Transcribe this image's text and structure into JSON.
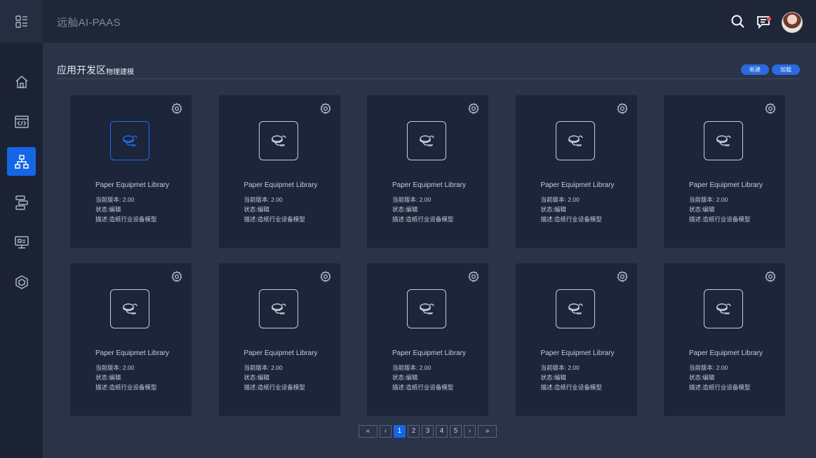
{
  "app": {
    "title": "远舢AI-PAAS"
  },
  "sidebar": {
    "items": [
      {
        "icon": "home-icon"
      },
      {
        "icon": "code-icon"
      },
      {
        "icon": "hierarchy-icon",
        "active": true
      },
      {
        "icon": "workflow-icon"
      },
      {
        "icon": "monitor-icon"
      },
      {
        "icon": "cube-icon"
      }
    ]
  },
  "header": {
    "icons": [
      "search-icon",
      "message-icon",
      "avatar"
    ]
  },
  "section": {
    "title": "应用开发区",
    "subtitle": "物理建模",
    "new_label": "新建",
    "load_label": "加载"
  },
  "cards": [
    {
      "name": "Paper Equipmet Library",
      "version": "当前版本: 2.00",
      "status": "状态:编辑",
      "desc": "描述:造纸行业设备模型",
      "active": true
    },
    {
      "name": "Paper Equipmet Library",
      "version": "当前版本: 2.00",
      "status": "状态:编辑",
      "desc": "描述:造纸行业设备模型"
    },
    {
      "name": "Paper Equipmet Library",
      "version": "当前版本: 2.00",
      "status": "状态:编辑",
      "desc": "描述:造纸行业设备模型"
    },
    {
      "name": "Paper Equipmet Library",
      "version": "当前版本: 2.00",
      "status": "状态:编辑",
      "desc": "描述:造纸行业设备模型"
    },
    {
      "name": "Paper Equipmet Library",
      "version": "当前版本: 2.00",
      "status": "状态:编辑",
      "desc": "描述:造纸行业设备模型"
    },
    {
      "name": "Paper Equipmet Library",
      "version": "当前版本: 2.00",
      "status": "状态:编辑",
      "desc": "描述:造纸行业设备模型"
    },
    {
      "name": "Paper Equipmet Library",
      "version": "当前版本: 2.00",
      "status": "状态:编辑",
      "desc": "描述:造纸行业设备模型"
    },
    {
      "name": "Paper Equipmet Library",
      "version": "当前版本: 2.00",
      "status": "状态:编辑",
      "desc": "描述:造纸行业设备模型"
    },
    {
      "name": "Paper Equipmet Library",
      "version": "当前版本: 2.00",
      "status": "状态:编辑",
      "desc": "描述:造纸行业设备模型"
    },
    {
      "name": "Paper Equipmet Library",
      "version": "当前版本: 2.00",
      "status": "状态:编辑",
      "desc": "描述:造纸行业设备模型"
    }
  ],
  "pagination": {
    "first": "«",
    "prev": "‹",
    "pages": [
      "1",
      "2",
      "3",
      "4",
      "5"
    ],
    "current": "1",
    "next": "›",
    "last": "»"
  },
  "colors": {
    "accent": "#1565e6",
    "background": "#2a3347",
    "card": "#1d253a",
    "sidebar": "#1b2233"
  }
}
